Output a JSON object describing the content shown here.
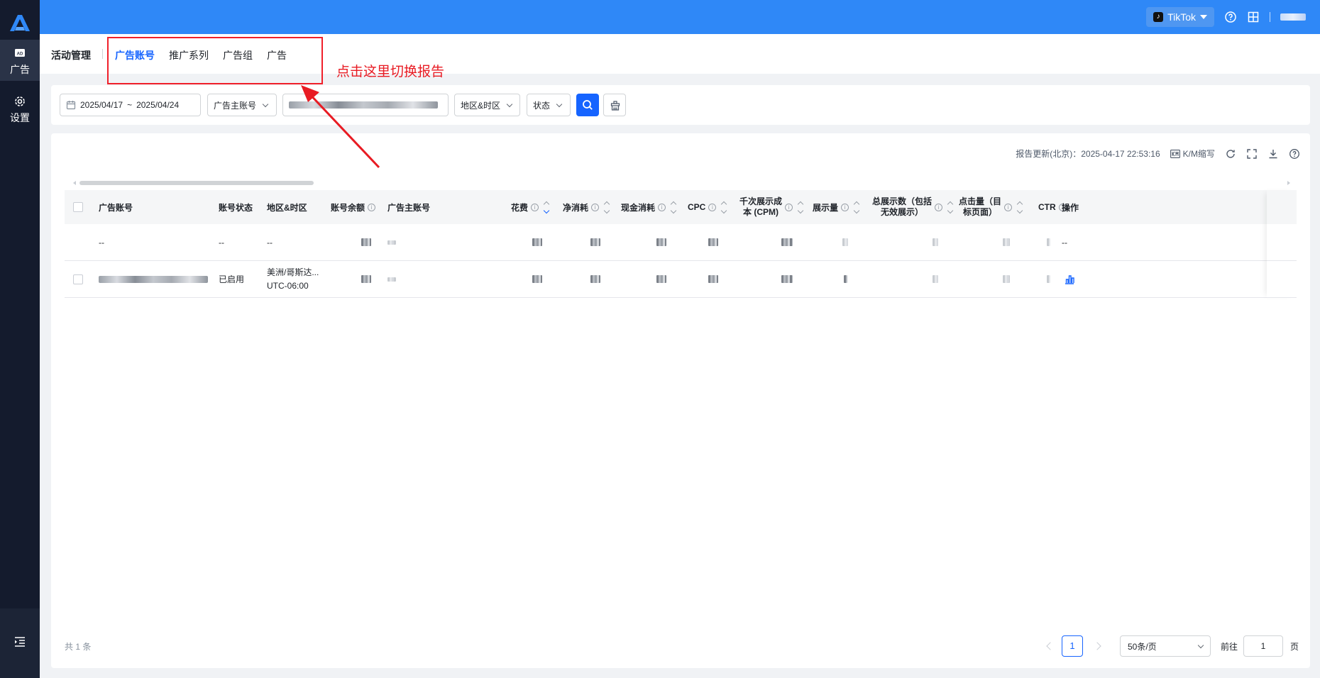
{
  "topbar": {
    "platform_label": "TikTok"
  },
  "sidebar": {
    "items": [
      {
        "label": "广告",
        "icon": "ad-icon"
      },
      {
        "label": "设置",
        "icon": "gear-icon"
      }
    ]
  },
  "subheader": {
    "title": "活动管理",
    "tabs": [
      {
        "label": "广告账号",
        "active": true
      },
      {
        "label": "推广系列",
        "active": false
      },
      {
        "label": "广告组",
        "active": false
      },
      {
        "label": "广告",
        "active": false
      }
    ]
  },
  "annotation": {
    "text": "点击这里切换报告",
    "color": "#e81b23"
  },
  "filters": {
    "date_start": "2025/04/17",
    "date_sep": "~",
    "date_end": "2025/04/24",
    "advertiser_account": "广告主账号",
    "region_timezone": "地区&时区",
    "status": "状态"
  },
  "toolbar": {
    "report_update": "报告更新(北京)：2025-04-17 22:53:16",
    "km_label": "K/M缩写"
  },
  "table": {
    "headers": {
      "account": "广告账号",
      "account_status": "账号状态",
      "region": "地区&时区",
      "balance": "账号余额",
      "advertiser": "广告主账号",
      "spend": "花费",
      "net_spend": "净消耗",
      "cash_spend": "现金消耗",
      "cpc": "CPC",
      "cpm_line1": "千次展示成",
      "cpm_line2": "本 (CPM)",
      "impressions": "展示量",
      "total_impr_line1": "总展示数（包括",
      "total_impr_line2": "无效展示）",
      "clicks_line1": "点击量（目",
      "clicks_line2": "标页面）",
      "ctr": "CTR",
      "actions": "操作"
    },
    "summary_row": {
      "account": "--",
      "status": "--",
      "region": "--",
      "actions": "--"
    },
    "rows": [
      {
        "status": "已启用",
        "region_line1": "美洲/哥斯达...",
        "region_line2": "UTC-06:00"
      }
    ]
  },
  "footer": {
    "total": "共 1 条",
    "current_page": "1",
    "page_size": "50条/页",
    "goto_label": "前往",
    "goto_value": "1",
    "goto_suffix": "页"
  },
  "colors": {
    "topbar": "#2f88f7",
    "sidebar": "#141b2d",
    "accent": "#1664ff"
  }
}
